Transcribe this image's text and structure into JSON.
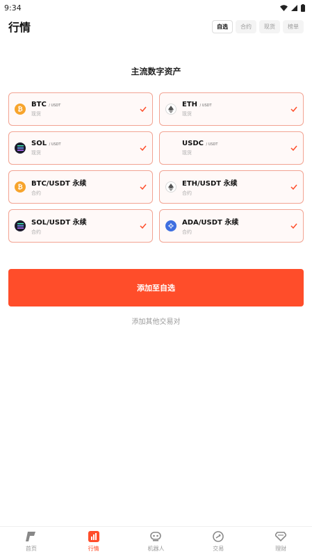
{
  "status_bar": {
    "time": "9:34"
  },
  "header": {
    "title": "行情",
    "tabs": [
      {
        "label": "自选",
        "active": true
      },
      {
        "label": "合约",
        "active": false
      },
      {
        "label": "现货",
        "active": false
      },
      {
        "label": "榜单",
        "active": false
      }
    ]
  },
  "section": {
    "title": "主流数字资产"
  },
  "assets": [
    {
      "name": "BTC",
      "quote": "/ USDT",
      "sub": "现货",
      "coin": "btc",
      "selected": true
    },
    {
      "name": "ETH",
      "quote": "/ USDT",
      "sub": "现货",
      "coin": "eth",
      "selected": true
    },
    {
      "name": "SOL",
      "quote": "/ USDT",
      "sub": "现货",
      "coin": "sol",
      "selected": true
    },
    {
      "name": "USDC",
      "quote": "/ USDT",
      "sub": "现货",
      "coin": "usdc",
      "selected": true
    },
    {
      "name": "BTC/USDT 永续",
      "quote": "",
      "sub": "合约",
      "coin": "btc",
      "selected": true
    },
    {
      "name": "ETH/USDT 永续",
      "quote": "",
      "sub": "合约",
      "coin": "eth",
      "selected": true
    },
    {
      "name": "SOL/USDT 永续",
      "quote": "",
      "sub": "合约",
      "coin": "sol",
      "selected": true
    },
    {
      "name": "ADA/USDT 永续",
      "quote": "",
      "sub": "合约",
      "coin": "ada",
      "selected": true
    }
  ],
  "actions": {
    "add_button": "添加至自选",
    "add_other": "添加其他交易对"
  },
  "bottom_nav": [
    {
      "label": "首页",
      "icon": "home-icon",
      "active": false
    },
    {
      "label": "行情",
      "icon": "market-icon",
      "active": true
    },
    {
      "label": "机器人",
      "icon": "robot-icon",
      "active": false
    },
    {
      "label": "交易",
      "icon": "trade-icon",
      "active": false
    },
    {
      "label": "理财",
      "icon": "finance-icon",
      "active": false
    }
  ],
  "colors": {
    "accent": "#ff4d2a",
    "card_border": "#f2a392",
    "btc": "#f7a42c",
    "ada": "#3f6fe0"
  }
}
